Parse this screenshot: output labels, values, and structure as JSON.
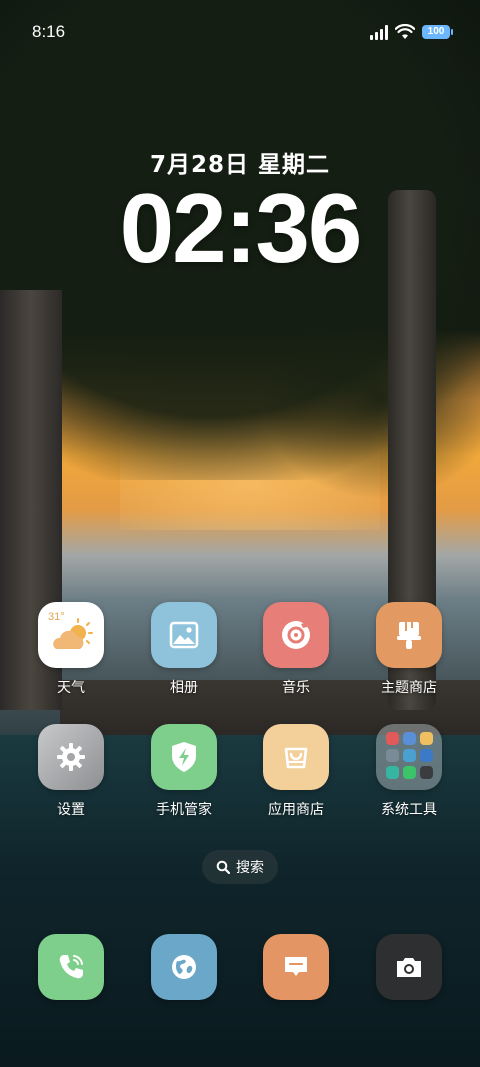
{
  "status_bar": {
    "time": "8:16",
    "battery": "100",
    "signal_icon": "signal-bars-icon",
    "wifi_icon": "wifi-icon",
    "battery_color": "#6cb5ff"
  },
  "clock_widget": {
    "date": "7月28日 星期二",
    "time": "02:36"
  },
  "apps": [
    {
      "label": "天气",
      "icon": "weather-icon",
      "color": "#ffffff",
      "temp": "31°"
    },
    {
      "label": "相册",
      "icon": "gallery-icon",
      "color": "#8fc3dc"
    },
    {
      "label": "音乐",
      "icon": "music-icon",
      "color": "#e77f78"
    },
    {
      "label": "主题商店",
      "icon": "theme-store-icon",
      "color": "#e39a62"
    },
    {
      "label": "设置",
      "icon": "settings-gear-icon",
      "color": "#a9aaac"
    },
    {
      "label": "手机管家",
      "icon": "phone-manager-shield-icon",
      "color": "#7fcf8c"
    },
    {
      "label": "应用商店",
      "icon": "app-store-bag-icon",
      "color": "#f3cf99"
    },
    {
      "label": "系统工具",
      "icon": "system-tools-folder-icon",
      "color": "#c0c7cb"
    }
  ],
  "search": {
    "label": "搜索",
    "icon": "search-icon"
  },
  "dock": [
    {
      "icon": "phone-icon",
      "color": "#7fcf8c"
    },
    {
      "icon": "browser-globe-icon",
      "color": "#6aa7c9"
    },
    {
      "icon": "messages-icon",
      "color": "#e39563"
    },
    {
      "icon": "camera-icon",
      "color": "#2e2f30"
    }
  ]
}
